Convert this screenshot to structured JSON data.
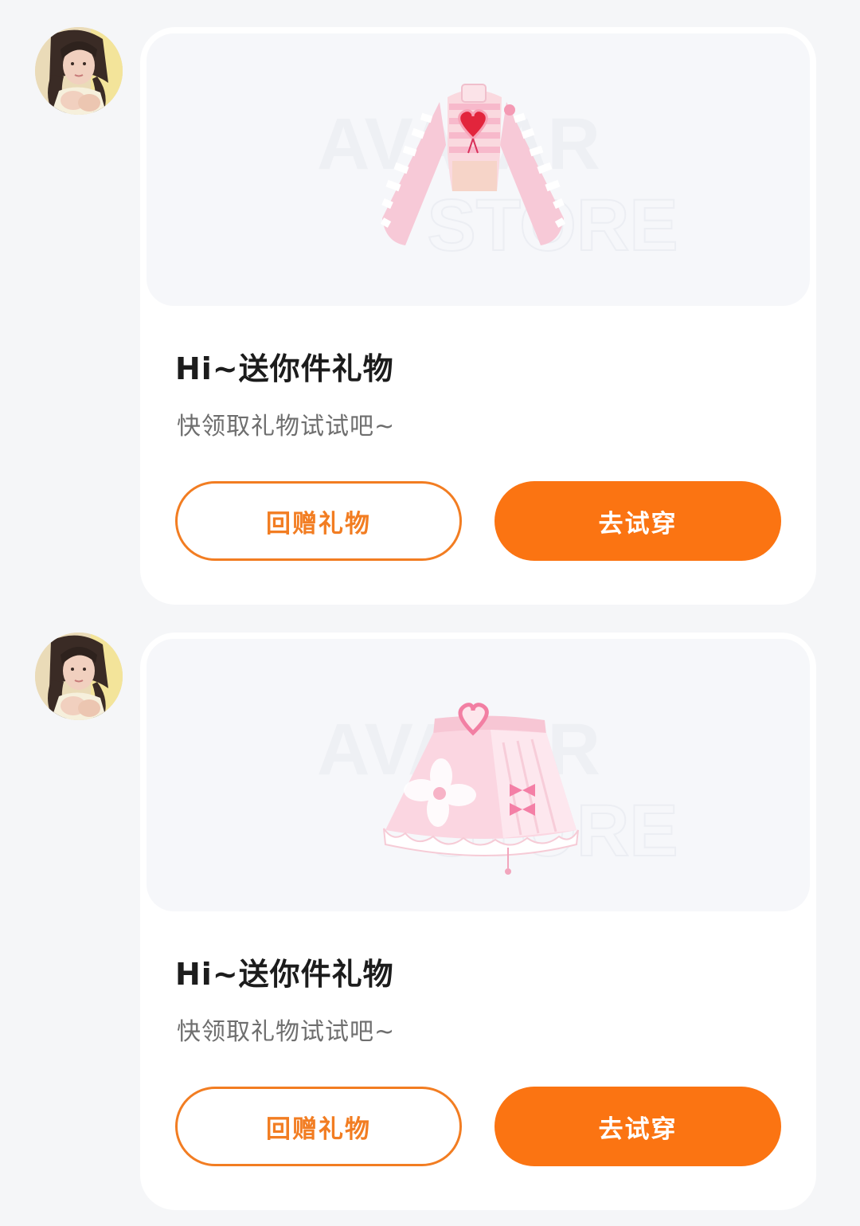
{
  "colors": {
    "page_bg": "#f5f6f8",
    "card_bg": "#ffffff",
    "accent": "#fb7412",
    "accent_outline": "#f27d22"
  },
  "messages": [
    {
      "avatar": "user-avatar-photo",
      "gift_item": "pink-striped-heart-crop-top",
      "watermark": [
        "AVATAR",
        "STORE"
      ],
      "title": "Hi~送你件礼物",
      "subtitle": "快领取礼物试试吧~",
      "return_gift_label": "回赠礼物",
      "try_on_label": "去试穿"
    },
    {
      "avatar": "user-avatar-photo",
      "gift_item": "pink-flower-bow-mini-skirt",
      "watermark": [
        "AVATAR",
        "STORE"
      ],
      "title": "Hi~送你件礼物",
      "subtitle": "快领取礼物试试吧~",
      "return_gift_label": "回赠礼物",
      "try_on_label": "去试穿"
    }
  ]
}
